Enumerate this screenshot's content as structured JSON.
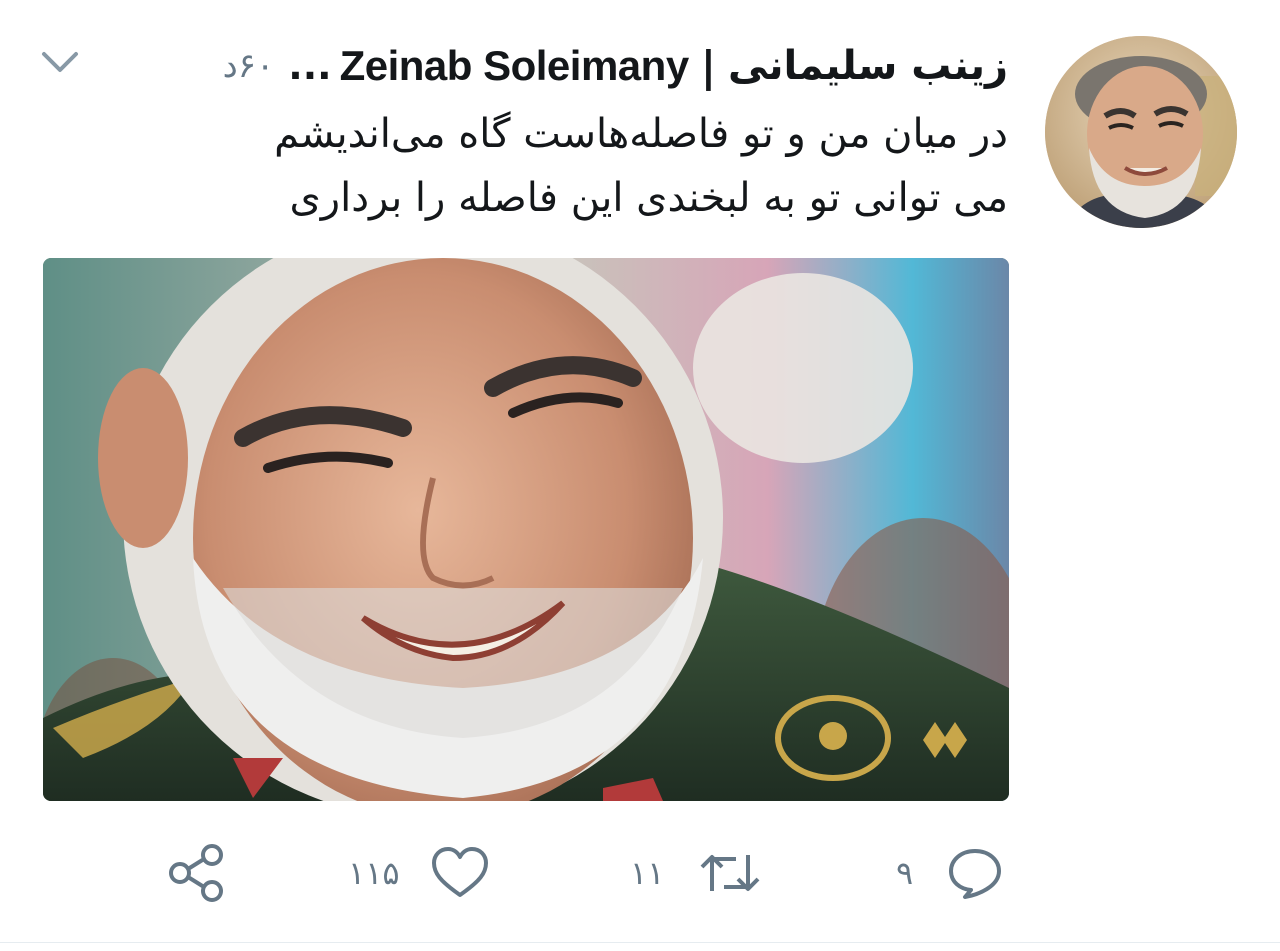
{
  "tweet": {
    "display_name_fa": "زینب سلیمانی",
    "separator": "|",
    "display_name_en": "Zeinab Soleimany",
    "ellipsis": "...",
    "timestamp": "۶۰د",
    "text_lines": [
      "در میان من و تو فاصله‌هاست گاه می‌اندیشم",
      "می توانی تو به لبخندی این فاصله را برداری"
    ]
  },
  "actions": {
    "reply_count": "۹",
    "retweet_count": "۱۱",
    "like_count": "۱۱۵"
  },
  "icons": {
    "menu": "chevron-down-icon",
    "reply": "reply-icon",
    "retweet": "retweet-icon",
    "like": "heart-icon",
    "share": "share-icon"
  },
  "colors": {
    "text": "#14171a",
    "secondary": "#657786",
    "divider": "#e6ecf0"
  }
}
